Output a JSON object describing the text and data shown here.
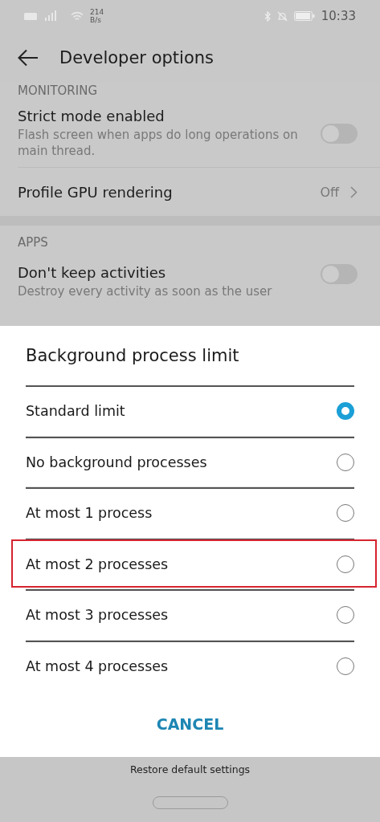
{
  "status_bar": {
    "net_speed": "214",
    "net_unit": "B/s",
    "time": "10:33"
  },
  "header": {
    "title": "Developer options"
  },
  "settings": [
    {
      "kind": "section",
      "label": "MONITORING"
    },
    {
      "kind": "toggle",
      "title": "Strict mode enabled",
      "subtitle": "Flash screen when apps do long operations on main thread.",
      "on": false
    },
    {
      "kind": "value",
      "title": "Profile GPU rendering",
      "value": "Off"
    },
    {
      "kind": "gap"
    },
    {
      "kind": "section",
      "label": "APPS"
    },
    {
      "kind": "toggle",
      "title": "Don't keep activities",
      "subtitle": "Destroy every activity as soon as the user",
      "on": false
    }
  ],
  "dialog": {
    "title": "Background process limit",
    "options": [
      {
        "label": "Standard limit",
        "selected": true,
        "highlighted": false
      },
      {
        "label": "No background processes",
        "selected": false,
        "highlighted": false
      },
      {
        "label": "At most 1 process",
        "selected": false,
        "highlighted": false
      },
      {
        "label": "At most 2 processes",
        "selected": false,
        "highlighted": true
      },
      {
        "label": "At most 3 processes",
        "selected": false,
        "highlighted": false
      },
      {
        "label": "At most 4 processes",
        "selected": false,
        "highlighted": false
      }
    ],
    "cancel": "CANCEL"
  },
  "footer": {
    "action": "Restore default settings"
  }
}
